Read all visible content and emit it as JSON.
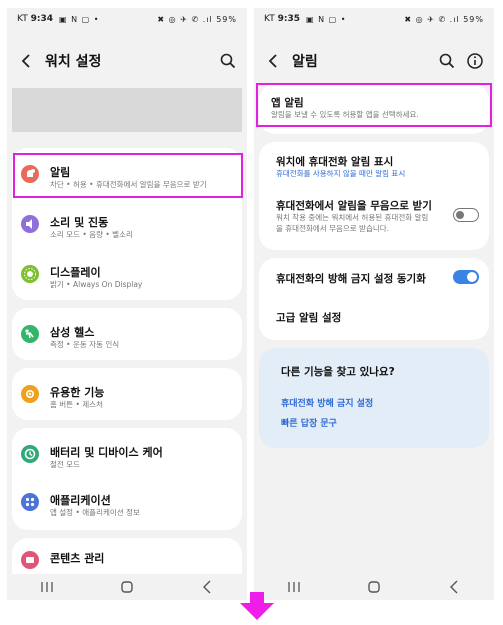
{
  "left_screen": {
    "status": {
      "carrier": "KT",
      "time": "9:34",
      "right": "✖ ◎ ✈ ✆ .ıl 59%"
    },
    "title": "워치 설정",
    "items": [
      {
        "label": "알림",
        "sub": "차단 • 허용 • 휴대전화에서 알림을 무음으로 받기",
        "icon": "bell-icon",
        "color": "#e86a5a"
      },
      {
        "label": "소리 및 진동",
        "sub": "소리 모드 • 음량 • 벨소리",
        "icon": "speaker-icon",
        "color": "#8f6fd9"
      },
      {
        "label": "디스플레이",
        "sub": "밝기 • Always On Display",
        "icon": "sun-icon",
        "color": "#7fbf2f"
      },
      {
        "label": "삼성 헬스",
        "sub": "측정 • 운동 자동 인식",
        "icon": "health-icon",
        "color": "#33b56a"
      },
      {
        "label": "유용한 기능",
        "sub": "홈 버튼 • 제스처",
        "icon": "star-icon",
        "color": "#f0a020"
      },
      {
        "label": "배터리 및 디바이스 케어",
        "sub": "절전 모드",
        "icon": "battery-care-icon",
        "color": "#2fa87a"
      },
      {
        "label": "애플리케이션",
        "sub": "앱 설정 • 애플리케이션 정보",
        "icon": "apps-icon",
        "color": "#4b74d6"
      },
      {
        "label": "콘텐츠 관리",
        "sub": "",
        "icon": "folder-icon",
        "color": "#e0567a"
      }
    ]
  },
  "right_screen": {
    "status": {
      "carrier": "KT",
      "time": "9:35",
      "right": "✖ ◎ ✈ ✆ .ıl 59%"
    },
    "title": "알림",
    "app_alert": {
      "label": "앱 알림",
      "sub": "알림을 보낼 수 있도록 허용할 앱을 선택하세요."
    },
    "watch_show": {
      "label": "워치에 휴대전화 알림 표시",
      "sub": "휴대전화를 사용하지 않을 때만 알림 표시"
    },
    "mute_on_phone": {
      "label": "휴대전화에서 알림을 무음으로 받기",
      "sub1": "워치 착용 중에는 워치에서 허용된 휴대전화 알림",
      "sub2": "을 휴대전화에서 무음으로 받습니다.",
      "state": "off"
    },
    "dnd_sync": {
      "label": "휴대전화의 방해 금지 설정 동기화",
      "state": "on"
    },
    "advanced": {
      "label": "고급 알림 설정"
    },
    "suggest": {
      "title": "다른 기능을 찾고 있나요?",
      "links": [
        "휴대전화 방해 금지 설정",
        "빠른 답장 문구"
      ]
    }
  },
  "colors": {
    "highlight": "#e51fe1",
    "arrow": "#ee1ee8",
    "link": "#2f6bd5",
    "toggle_on": "#3a82e4"
  }
}
